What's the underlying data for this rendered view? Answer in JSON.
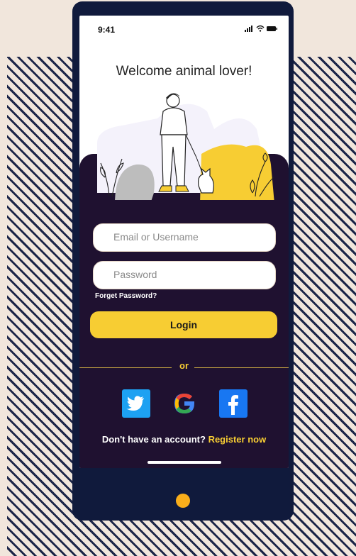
{
  "status": {
    "time": "9:41",
    "icons": [
      "signal-icon",
      "wifi-icon",
      "battery-icon"
    ]
  },
  "welcome": "Welcome animal lover!",
  "form": {
    "email_placeholder": "Email or Username",
    "password_placeholder": "Password",
    "forgot_label": "Forget Password?",
    "login_label": "Login",
    "or_label": "or"
  },
  "social": [
    "twitter-icon",
    "google-icon",
    "facebook-icon"
  ],
  "signup": {
    "prompt": "Don't have an account?",
    "link": "Register now"
  },
  "colors": {
    "dark_panel": "#1f1130",
    "accent": "#f7cd33",
    "device": "#101a3c",
    "home_button": "#f9ae1b"
  }
}
